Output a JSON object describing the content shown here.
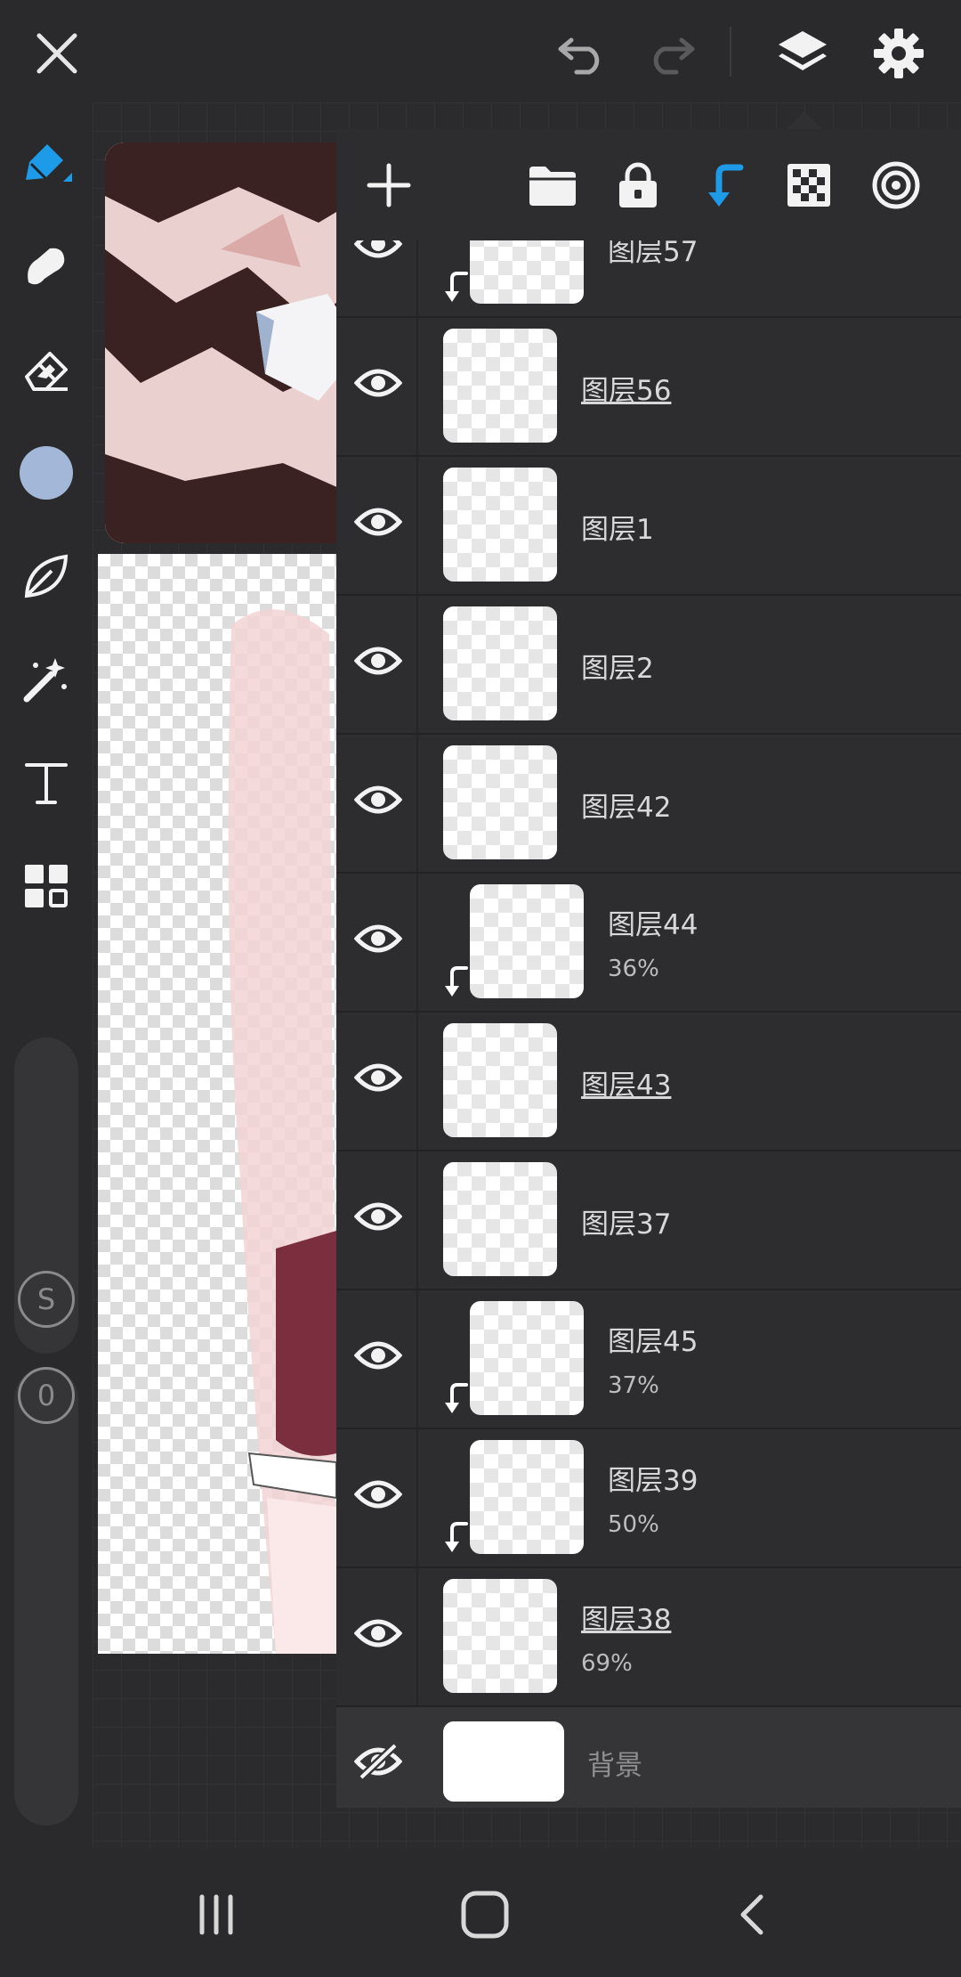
{
  "toolbar": {
    "icons": [
      "close-icon",
      "undo-icon",
      "redo-icon",
      "layers-icon",
      "settings-icon"
    ]
  },
  "tools": [
    "pen-icon",
    "smudge-icon",
    "eraser-icon",
    "color-swatch",
    "leaf-icon",
    "magic-wand-icon",
    "text-icon",
    "grid-icon"
  ],
  "colors": {
    "accent": "#1e9be8",
    "swatch": "#a3b8d8",
    "panel": "#2d2d30",
    "background": "#222224"
  },
  "side_sliders": {
    "size_label": "S",
    "opacity_label": "0"
  },
  "layer_panel": {
    "toolbar_icons": [
      "add-icon",
      "folder-icon",
      "lock-icon",
      "clip-icon",
      "transparency-icon",
      "target-icon"
    ],
    "layers": [
      {
        "name": "图层57",
        "opacity": "",
        "clipped": true,
        "visible": true,
        "underline": false
      },
      {
        "name": "图层56",
        "opacity": "",
        "clipped": false,
        "visible": true,
        "underline": true
      },
      {
        "name": "图层1",
        "opacity": "",
        "clipped": false,
        "visible": true,
        "underline": false
      },
      {
        "name": "图层2",
        "opacity": "",
        "clipped": false,
        "visible": true,
        "underline": false
      },
      {
        "name": "图层42",
        "opacity": "",
        "clipped": false,
        "visible": true,
        "underline": false
      },
      {
        "name": "图层44",
        "opacity": "36%",
        "clipped": true,
        "visible": true,
        "underline": false
      },
      {
        "name": "图层43",
        "opacity": "",
        "clipped": false,
        "visible": true,
        "underline": true
      },
      {
        "name": "图层37",
        "opacity": "",
        "clipped": false,
        "visible": true,
        "underline": false
      },
      {
        "name": "图层45",
        "opacity": "37%",
        "clipped": true,
        "visible": true,
        "underline": false
      },
      {
        "name": "图层39",
        "opacity": "50%",
        "clipped": true,
        "visible": true,
        "underline": false
      },
      {
        "name": "图层38",
        "opacity": "69%",
        "clipped": false,
        "visible": true,
        "underline": true
      }
    ],
    "background_layer": {
      "name": "背景",
      "visible": false
    }
  },
  "navbar": {
    "icons": [
      "recents-icon",
      "home-icon",
      "back-icon"
    ]
  }
}
